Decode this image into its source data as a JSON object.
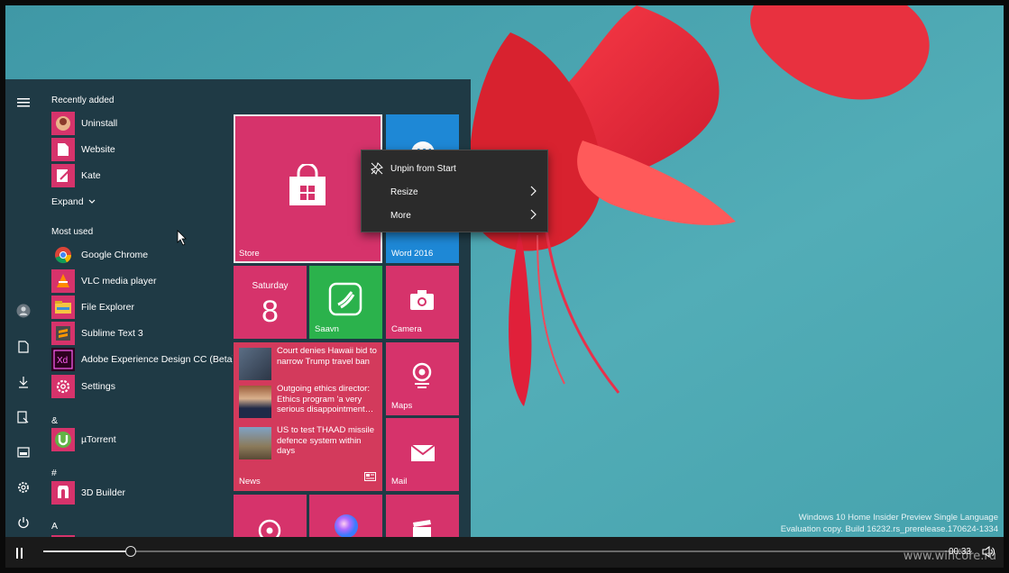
{
  "start_menu": {
    "recently_added_header": "Recently added",
    "recently_added": [
      {
        "label": "Uninstall",
        "icon": "uninstall-icon"
      },
      {
        "label": "Website",
        "icon": "website-icon"
      },
      {
        "label": "Kate",
        "icon": "kate-icon"
      }
    ],
    "expand_label": "Expand",
    "most_used_header": "Most used",
    "most_used": [
      {
        "label": "Google Chrome",
        "icon": "chrome-icon"
      },
      {
        "label": "VLC media player",
        "icon": "vlc-icon"
      },
      {
        "label": "File Explorer",
        "icon": "folder-icon"
      },
      {
        "label": "Sublime Text 3",
        "icon": "sublime-icon"
      },
      {
        "label": "Adobe Experience Design CC (Beta)",
        "icon": "adobe-xd-icon"
      },
      {
        "label": "Settings",
        "icon": "gear-icon"
      }
    ],
    "group_amp": "&",
    "utorrent": "µTorrent",
    "group_hash": "#",
    "builder": "3D Builder",
    "group_a": "A"
  },
  "tiles": {
    "store": "Store",
    "word": "Word 2016",
    "calendar_day": "Saturday",
    "calendar_date": "8",
    "saavn": "Saavn",
    "camera": "Camera",
    "maps": "Maps",
    "news": "News",
    "mail": "Mail",
    "news_items": [
      "Court denies Hawaii bid to narrow Trump travel ban",
      "Outgoing ethics director: Ethics program 'a very serious disappointment…",
      "US to test THAAD missile defence system within days"
    ]
  },
  "context_menu": {
    "unpin": "Unpin from Start",
    "resize": "Resize",
    "more": "More"
  },
  "watermark": {
    "line1": "Windows 10 Home Insider Preview Single Language",
    "line2": "Evaluation copy. Build 16232.rs_prerelease.170624-1334"
  },
  "player": {
    "time": "00:33",
    "progress": 0.094,
    "site": "www.wincore.ru"
  },
  "colors": {
    "tile_pink": "#d6336b",
    "tile_green": "#2bb24c",
    "tile_blue": "#1e88d6",
    "start_bg": "#1f3a45"
  }
}
